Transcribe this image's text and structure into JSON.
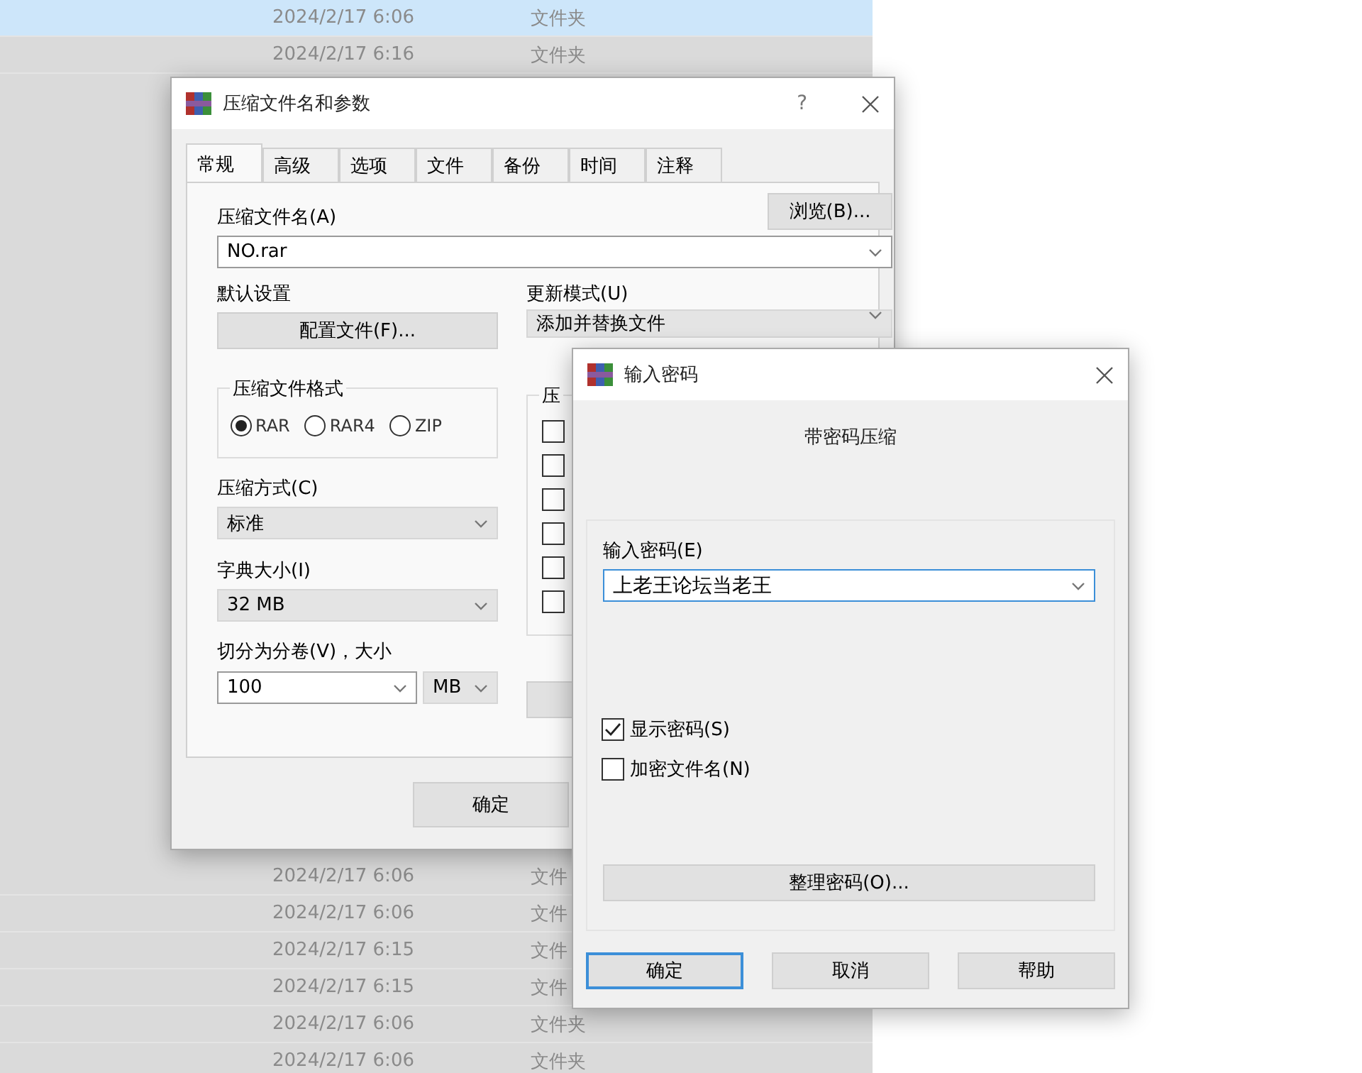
{
  "file_list": {
    "rows_top": [
      {
        "date": "2024/2/17 6:06",
        "type": "文件夹",
        "selected": true
      },
      {
        "date": "2024/2/17 6:16",
        "type": "文件夹",
        "selected": false
      }
    ],
    "rows_bottom": [
      {
        "date": "2024/2/17 6:06",
        "type": "文件",
        "selected": false
      },
      {
        "date": "2024/2/17 6:06",
        "type": "文件",
        "selected": false
      },
      {
        "date": "2024/2/17 6:15",
        "type": "文件",
        "selected": false
      },
      {
        "date": "2024/2/17 6:15",
        "type": "文件",
        "selected": false
      },
      {
        "date": "2024/2/17 6:06",
        "type": "文件夹",
        "selected": false
      },
      {
        "date": "2024/2/17 6:06",
        "type": "文件夹",
        "selected": false
      }
    ]
  },
  "archive_dialog": {
    "title": "压缩文件名和参数",
    "help": "?",
    "tabs": [
      {
        "label": "常规",
        "selected": true
      },
      {
        "label": "高级",
        "selected": false
      },
      {
        "label": "选项",
        "selected": false
      },
      {
        "label": "文件",
        "selected": false
      },
      {
        "label": "备份",
        "selected": false
      },
      {
        "label": "时间",
        "selected": false
      },
      {
        "label": "注释",
        "selected": false
      }
    ],
    "archive_name_label": "压缩文件名(A)",
    "browse_button": "浏览(B)...",
    "archive_name_value": "NO.rar",
    "default_settings_label": "默认设置",
    "profiles_button": "配置文件(F)...",
    "update_mode_label": "更新模式(U)",
    "update_mode_value": "添加并替换文件",
    "format_group": {
      "title": "压缩文件格式",
      "options": [
        {
          "label": "RAR",
          "selected": true
        },
        {
          "label": "RAR4",
          "selected": false
        },
        {
          "label": "ZIP",
          "selected": false
        }
      ]
    },
    "options_group": {
      "title": "压",
      "checkboxes": [
        {
          "checked": false
        },
        {
          "checked": false
        },
        {
          "checked": false
        },
        {
          "checked": false
        },
        {
          "checked": false
        },
        {
          "checked": false
        }
      ]
    },
    "method_label": "压缩方式(C)",
    "method_value": "标准",
    "dictionary_label": "字典大小(I)",
    "dictionary_value": "32 MB",
    "split_label": "切分为分卷(V)，大小",
    "split_value": "100",
    "split_unit": "MB",
    "ok_button": "确定"
  },
  "password_dialog": {
    "title": "输入密码",
    "heading": "带密码压缩",
    "password_label": "输入密码(E)",
    "password_value": "上老王论坛当老王",
    "options": [
      {
        "label": "显示密码(S)",
        "checked": true
      },
      {
        "label": "加密文件名(N)",
        "checked": false
      }
    ],
    "organize_button": "整理密码(O)...",
    "buttons": [
      {
        "label": "确定",
        "default": true
      },
      {
        "label": "取消",
        "default": false
      },
      {
        "label": "帮助",
        "default": false
      }
    ]
  }
}
